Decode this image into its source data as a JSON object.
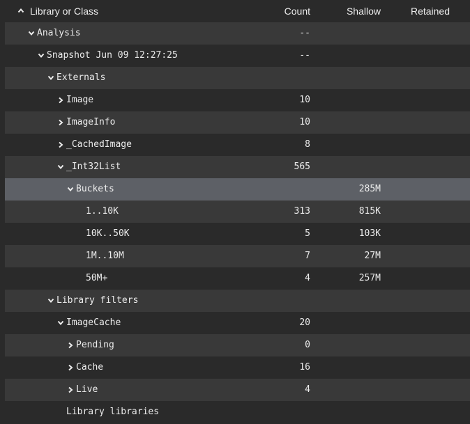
{
  "header": {
    "name": "Library or Class",
    "count": "Count",
    "shallow": "Shallow",
    "retained": "Retained"
  },
  "rows": [
    {
      "name": "Analysis",
      "count": "--",
      "shallow": "",
      "retained": "",
      "depth": 0,
      "expander": "expanded"
    },
    {
      "name": "Snapshot Jun 09 12:27:25",
      "count": "--",
      "shallow": "",
      "retained": "",
      "depth": 1,
      "expander": "expanded"
    },
    {
      "name": "Externals",
      "count": "",
      "shallow": "",
      "retained": "",
      "depth": 2,
      "expander": "expanded"
    },
    {
      "name": "Image",
      "count": "10",
      "shallow": "",
      "retained": "",
      "depth": 3,
      "expander": "collapsed"
    },
    {
      "name": "ImageInfo",
      "count": "10",
      "shallow": "",
      "retained": "",
      "depth": 3,
      "expander": "collapsed"
    },
    {
      "name": "_CachedImage",
      "count": "8",
      "shallow": "",
      "retained": "",
      "depth": 3,
      "expander": "collapsed"
    },
    {
      "name": "_Int32List",
      "count": "565",
      "shallow": "",
      "retained": "",
      "depth": 3,
      "expander": "expanded"
    },
    {
      "name": "Buckets",
      "count": "",
      "shallow": "285M",
      "retained": "",
      "depth": 4,
      "expander": "expanded",
      "selected": true
    },
    {
      "name": "1..10K",
      "count": "313",
      "shallow": "815K",
      "retained": "",
      "depth": 5,
      "expander": "none"
    },
    {
      "name": "10K..50K",
      "count": "5",
      "shallow": "103K",
      "retained": "",
      "depth": 5,
      "expander": "none"
    },
    {
      "name": "1M..10M",
      "count": "7",
      "shallow": "27M",
      "retained": "",
      "depth": 5,
      "expander": "none"
    },
    {
      "name": "50M+",
      "count": "4",
      "shallow": "257M",
      "retained": "",
      "depth": 5,
      "expander": "none"
    },
    {
      "name": "Library filters",
      "count": "",
      "shallow": "",
      "retained": "",
      "depth": 2,
      "expander": "expanded"
    },
    {
      "name": "ImageCache",
      "count": "20",
      "shallow": "",
      "retained": "",
      "depth": 3,
      "expander": "expanded"
    },
    {
      "name": "Pending",
      "count": "0",
      "shallow": "",
      "retained": "",
      "depth": 4,
      "expander": "collapsed"
    },
    {
      "name": "Cache",
      "count": "16",
      "shallow": "",
      "retained": "",
      "depth": 4,
      "expander": "collapsed"
    },
    {
      "name": "Live",
      "count": "4",
      "shallow": "",
      "retained": "",
      "depth": 4,
      "expander": "collapsed"
    },
    {
      "name": "Library libraries",
      "count": "",
      "shallow": "",
      "retained": "",
      "depth": 3,
      "expander": "none"
    }
  ],
  "colors": {
    "background": "#2a2a2a",
    "row_alt": "#393939",
    "row_selected": "#5d6066",
    "text": "#ececec"
  },
  "icons": {
    "sort": "chevron-up-icon",
    "expanded": "chevron-down-icon",
    "collapsed": "chevron-right-icon"
  }
}
